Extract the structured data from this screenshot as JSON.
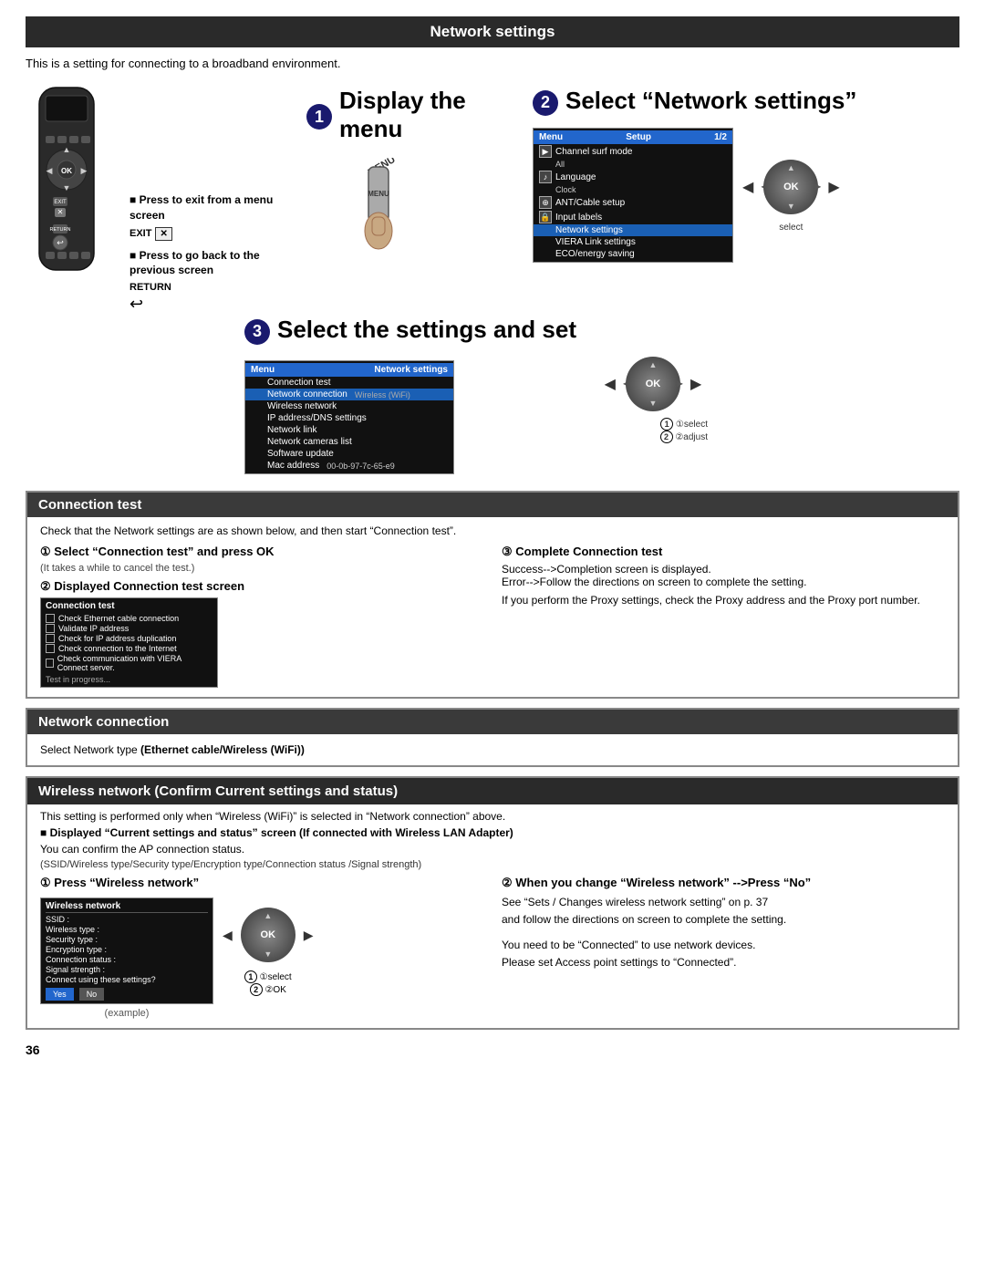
{
  "header": {
    "title": "Network settings"
  },
  "intro": {
    "text": "This is a setting for connecting to a broadband environment."
  },
  "steps": [
    {
      "number": "1",
      "title": "Display the menu"
    },
    {
      "number": "2",
      "title": "Select “Network settings”"
    },
    {
      "number": "3",
      "title": "Select the settings and set"
    }
  ],
  "remote_notes": {
    "exit_note": "Press to exit from a menu screen",
    "exit_key": "EXIT",
    "back_note": "Press to go back to the previous screen",
    "back_key": "RETURN"
  },
  "menu_setup": {
    "header_left": "Menu",
    "header_right": "Setup",
    "header_page": "1/2",
    "items": [
      "Channel surf mode",
      "All",
      "Language",
      "Clock",
      "ANT/Cable setup",
      "Input labels",
      "Network settings",
      "VIERA Link settings",
      "ECO/energy saving"
    ],
    "selected": "Network settings",
    "select_label": "select"
  },
  "menu_network": {
    "header_left": "Menu",
    "header_right": "Network settings",
    "items": [
      "Connection test",
      "Network connection",
      "Wireless (WiFi)",
      "Wireless network",
      "IP address/DNS settings",
      "Network link",
      "Network cameras list",
      "Software update",
      "Mac address",
      "00-0b-97-7c-65-e9"
    ],
    "select_label": "①select",
    "adjust_label": "②adjust"
  },
  "connection_test": {
    "section_title": "Connection test",
    "note": "Check that the Network settings are as shown below, and then start “Connection test”.",
    "step1_title": "① Select “Connection test” and press OK",
    "step1_sub": "(It takes a while to cancel the test.)",
    "step2_title": "② Displayed Connection test screen",
    "screen_title": "Connection test",
    "screen_rows": [
      "Check Ethernet cable connection",
      "Validate IP address",
      "Check for IP address duplication",
      "Check connection to the Internet",
      "Check communication with VIERA Connect server.",
      "Test in progress..."
    ],
    "step3_title": "③ Complete Connection test",
    "step3_lines": [
      "Success-->Completion screen is displayed.",
      "Error-->Follow the directions on screen to complete the setting.",
      "If you perform the Proxy settings, check the Proxy address and the Proxy port number."
    ]
  },
  "network_connection": {
    "section_title": "Network connection",
    "text": "Select Network type (Ethernet cable/Wireless (WiFi))"
  },
  "wireless_network": {
    "section_title": "Wireless network (Confirm Current settings and status)",
    "note": "This setting is performed only when “Wireless (WiFi)” is selected in “Network connection” above.",
    "bold_note": "■ Displayed “Current settings and status” screen (If connected with Wireless LAN Adapter)",
    "sub_note": "You can confirm the AP connection status.",
    "ssid_note": "(SSID/Wireless type/Security type/Encryption type/Connection status /Signal strength)",
    "step1_title": "① Press “Wireless network”",
    "step2_title": "② When you change “Wireless network” -->Press “No”",
    "step2_lines": [
      "See “Sets / Changes wireless network setting” on p. 37",
      "and follow the directions on screen to complete the setting.",
      "",
      "You need to be “Connected” to use network devices.",
      "Please set Access point settings to “Connected”."
    ],
    "screen_title": "Wireless network",
    "screen_rows": [
      "SSID :",
      "Wireless type :",
      "Security type :",
      "Encryption type :",
      "Connection status :",
      "Signal strength :",
      "Connect using these settings?"
    ],
    "screen_btn_yes": "Yes",
    "screen_btn_no": "No",
    "example_label": "(example)",
    "select_label": "①select",
    "ok_label": "②OK"
  },
  "page_number": "36"
}
